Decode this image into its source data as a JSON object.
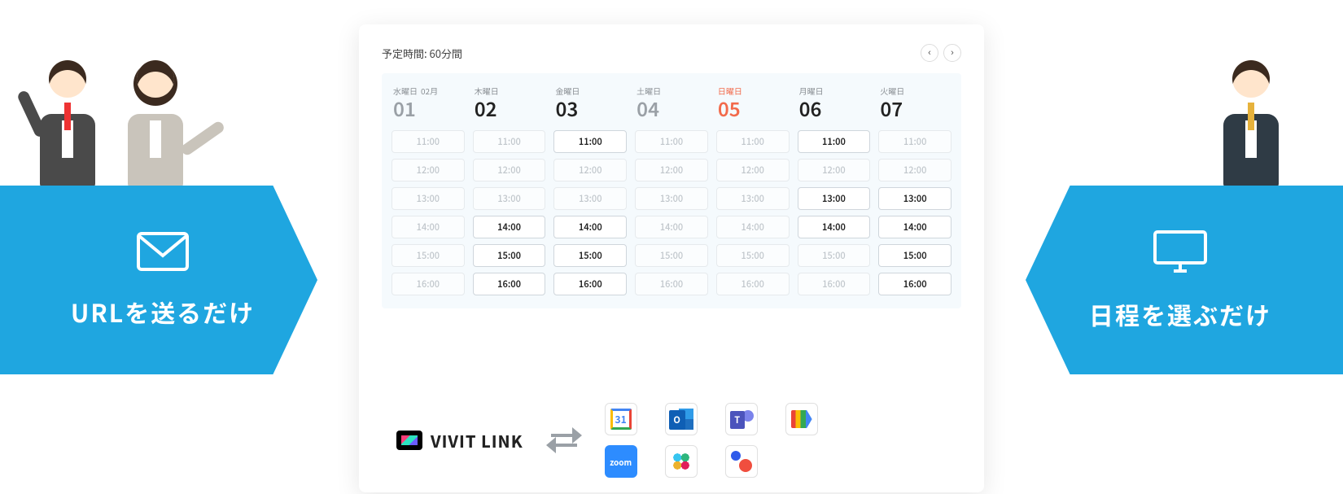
{
  "left_banner": {
    "caption": "URLを送るだけ"
  },
  "right_banner": {
    "caption": "日程を選ぶだけ"
  },
  "card": {
    "duration_label": "予定時間: 60分間",
    "month_label": "02月",
    "days": [
      {
        "dow": "水曜日",
        "num": "01",
        "active": false,
        "sun": false,
        "slots": [
          {
            "t": "11:00",
            "on": false
          },
          {
            "t": "12:00",
            "on": false
          },
          {
            "t": "13:00",
            "on": false
          },
          {
            "t": "14:00",
            "on": false
          },
          {
            "t": "15:00",
            "on": false
          },
          {
            "t": "16:00",
            "on": false
          }
        ]
      },
      {
        "dow": "木曜日",
        "num": "02",
        "active": true,
        "sun": false,
        "slots": [
          {
            "t": "11:00",
            "on": false
          },
          {
            "t": "12:00",
            "on": false
          },
          {
            "t": "13:00",
            "on": false
          },
          {
            "t": "14:00",
            "on": true
          },
          {
            "t": "15:00",
            "on": true
          },
          {
            "t": "16:00",
            "on": true
          }
        ]
      },
      {
        "dow": "金曜日",
        "num": "03",
        "active": true,
        "sun": false,
        "slots": [
          {
            "t": "11:00",
            "on": true
          },
          {
            "t": "12:00",
            "on": false
          },
          {
            "t": "13:00",
            "on": false
          },
          {
            "t": "14:00",
            "on": true
          },
          {
            "t": "15:00",
            "on": true
          },
          {
            "t": "16:00",
            "on": true
          }
        ]
      },
      {
        "dow": "土曜日",
        "num": "04",
        "active": false,
        "sun": false,
        "slots": [
          {
            "t": "11:00",
            "on": false
          },
          {
            "t": "12:00",
            "on": false
          },
          {
            "t": "13:00",
            "on": false
          },
          {
            "t": "14:00",
            "on": false
          },
          {
            "t": "15:00",
            "on": false
          },
          {
            "t": "16:00",
            "on": false
          }
        ]
      },
      {
        "dow": "日曜日",
        "num": "05",
        "active": false,
        "sun": true,
        "slots": [
          {
            "t": "11:00",
            "on": false
          },
          {
            "t": "12:00",
            "on": false
          },
          {
            "t": "13:00",
            "on": false
          },
          {
            "t": "14:00",
            "on": false
          },
          {
            "t": "15:00",
            "on": false
          },
          {
            "t": "16:00",
            "on": false
          }
        ]
      },
      {
        "dow": "月曜日",
        "num": "06",
        "active": true,
        "sun": false,
        "slots": [
          {
            "t": "11:00",
            "on": true
          },
          {
            "t": "12:00",
            "on": false
          },
          {
            "t": "13:00",
            "on": true
          },
          {
            "t": "14:00",
            "on": true
          },
          {
            "t": "15:00",
            "on": false
          },
          {
            "t": "16:00",
            "on": false
          }
        ]
      },
      {
        "dow": "火曜日",
        "num": "07",
        "active": true,
        "sun": false,
        "slots": [
          {
            "t": "11:00",
            "on": false
          },
          {
            "t": "12:00",
            "on": false
          },
          {
            "t": "13:00",
            "on": true
          },
          {
            "t": "14:00",
            "on": true
          },
          {
            "t": "15:00",
            "on": true
          },
          {
            "t": "16:00",
            "on": true
          }
        ]
      }
    ]
  },
  "brand": {
    "name_a": "VIVIT",
    "name_b": "LINK"
  },
  "apps": [
    "google-calendar",
    "outlook",
    "microsoft-teams",
    "google-meet",
    "zoom",
    "slack",
    "other"
  ]
}
